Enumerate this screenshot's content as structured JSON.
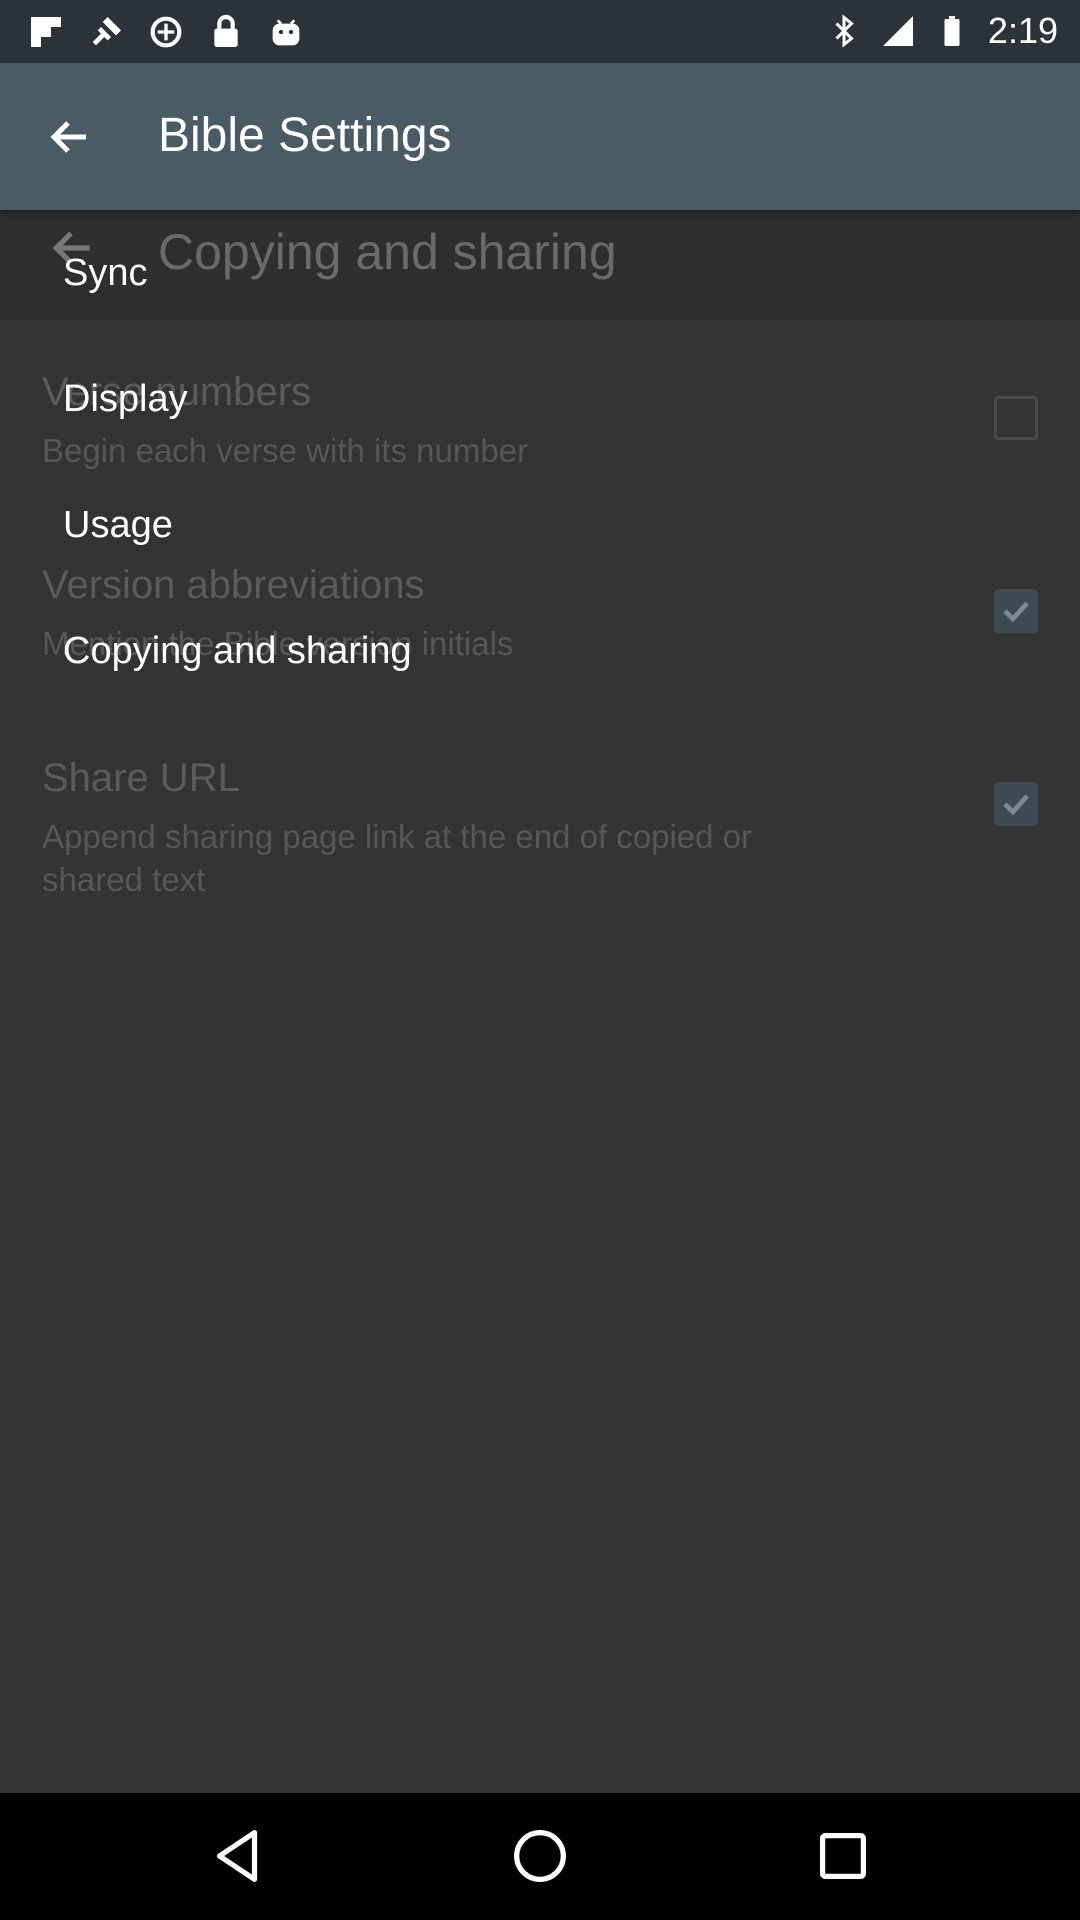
{
  "status_bar": {
    "time": "2:19",
    "left_icons": [
      "flipboard-icon",
      "fake-gps-icon",
      "data-saver-icon",
      "lock-icon",
      "android-icon"
    ],
    "right_icons": [
      "bluetooth-icon",
      "signal-icon",
      "battery-icon"
    ]
  },
  "app_bar": {
    "title": "Bible Settings"
  },
  "menu": {
    "items": [
      {
        "label": "Sync"
      },
      {
        "label": "Display"
      },
      {
        "label": "Usage"
      },
      {
        "label": "Copying and sharing"
      }
    ]
  },
  "background_page": {
    "title": "Copying and sharing",
    "prefs": [
      {
        "title": "Verse numbers",
        "summary": "Begin each verse with its number",
        "checked": false
      },
      {
        "title": "Version abbreviations",
        "summary": "Mention the Bible version initials",
        "checked": true
      },
      {
        "title": "Share URL",
        "summary": "Append sharing page link at the end of copied or shared text",
        "checked": true
      }
    ]
  },
  "nav_bar": {
    "buttons": [
      "back-icon",
      "home-icon",
      "recents-icon"
    ]
  }
}
